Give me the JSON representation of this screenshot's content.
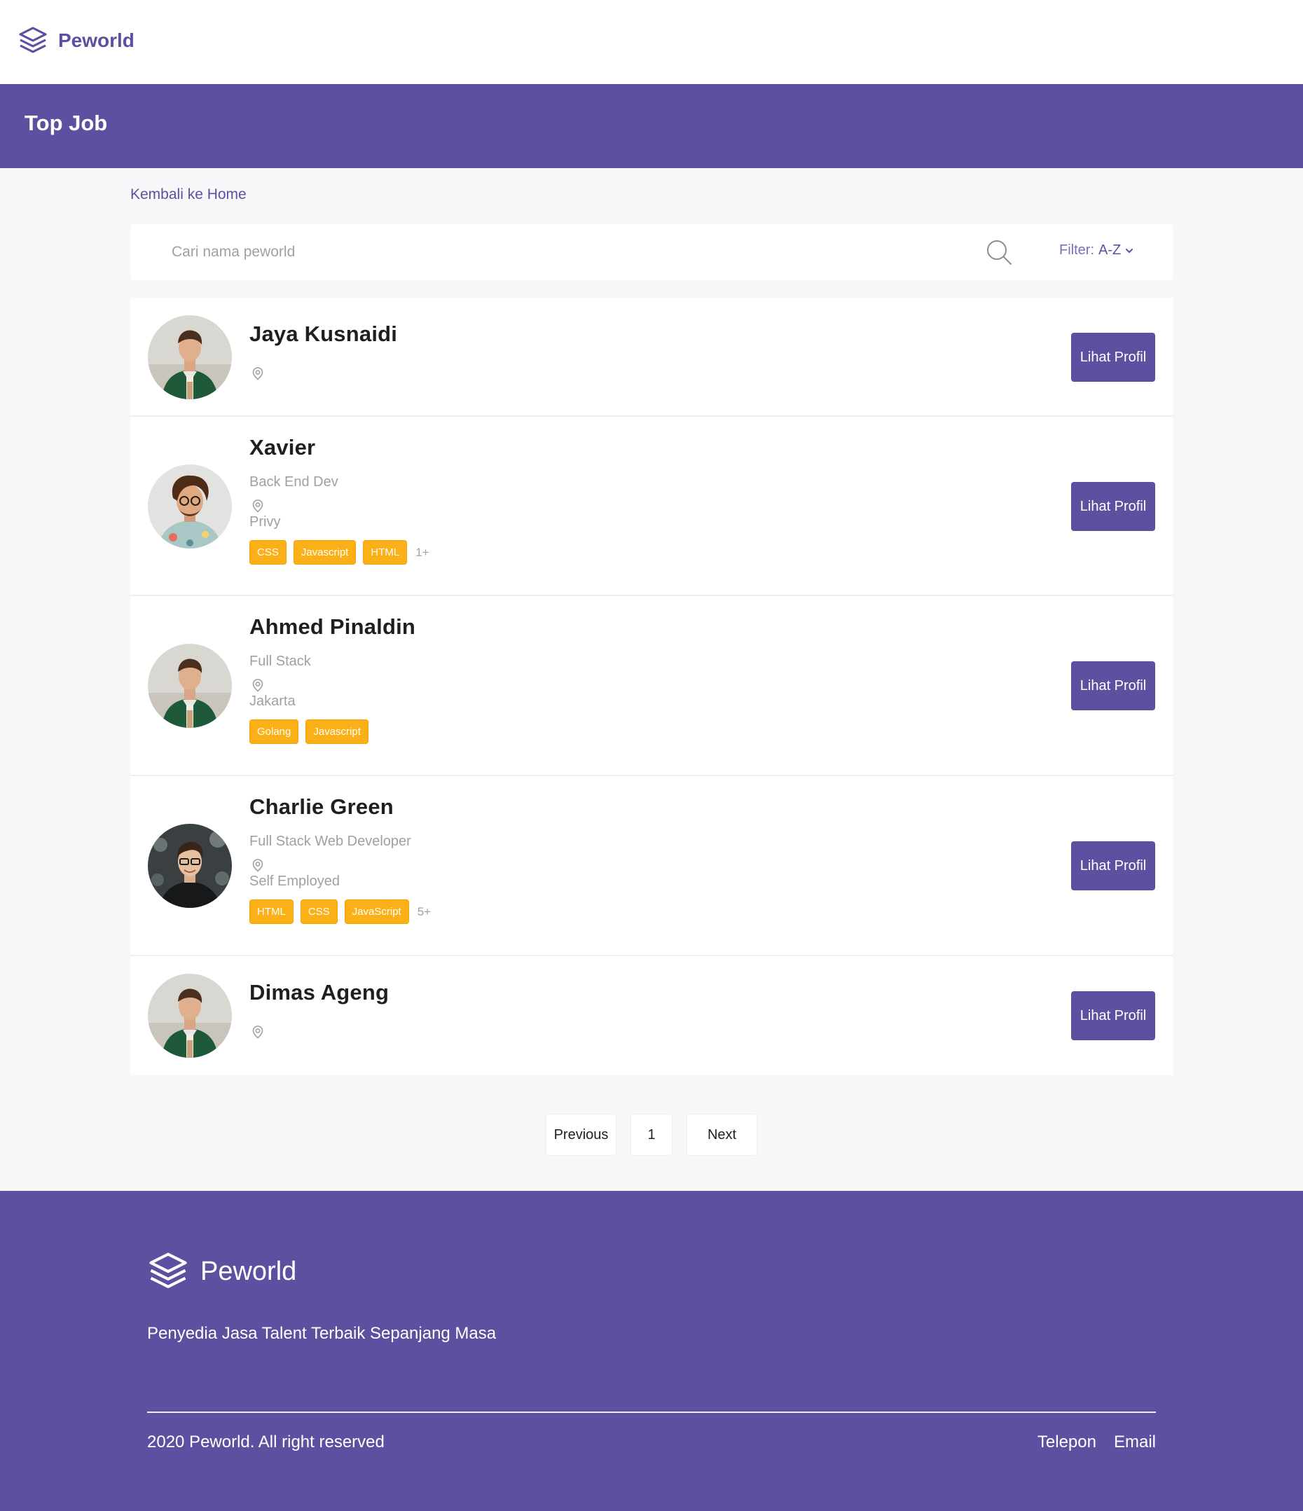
{
  "nav": {
    "brand": "Peworld"
  },
  "banner": {
    "title": "Top Job"
  },
  "back_link": "Kembali ke Home",
  "search": {
    "placeholder": "Cari nama peworld",
    "value": "",
    "filter_label": "Filter:",
    "filter_value": "A-Z"
  },
  "talents": [
    {
      "name": "Jaya Kusnaidi",
      "job": "",
      "location": "",
      "skills": [],
      "more": "",
      "button": "Lihat Profil",
      "avatar": "avatar-man-green-sweater"
    },
    {
      "name": "Xavier",
      "job": "Back End Dev",
      "location": "Privy",
      "skills": [
        "CSS",
        "Javascript",
        "HTML"
      ],
      "more": "1+",
      "button": "Lihat Profil",
      "avatar": "avatar-man-curly-hair"
    },
    {
      "name": "Ahmed Pinaldin",
      "job": "Full Stack",
      "location": "Jakarta",
      "skills": [
        "Golang",
        "Javascript"
      ],
      "more": "",
      "button": "Lihat Profil",
      "avatar": "avatar-man-green-sweater"
    },
    {
      "name": "Charlie Green",
      "job": "Full Stack Web Developer",
      "location": "Self Employed",
      "skills": [
        "HTML",
        "CSS",
        "JavaScript"
      ],
      "more": "5+",
      "button": "Lihat Profil",
      "avatar": "avatar-man-glasses"
    },
    {
      "name": "Dimas Ageng",
      "job": "",
      "location": "",
      "skills": [],
      "more": "",
      "button": "Lihat Profil",
      "avatar": "avatar-man-green-sweater"
    }
  ],
  "pagination": {
    "previous": "Previous",
    "current": "1",
    "next": "Next"
  },
  "footer": {
    "brand": "Peworld",
    "tagline": "Penyedia Jasa Talent Terbaik Sepanjang Masa",
    "copyright": "2020 Peworld. All right reserved",
    "links": [
      "Telepon",
      "Email"
    ]
  },
  "colors": {
    "primary": "#5e50a1",
    "skill": "#fbb017",
    "muted": "#9ea0a5",
    "background": "#f6f7f8"
  }
}
